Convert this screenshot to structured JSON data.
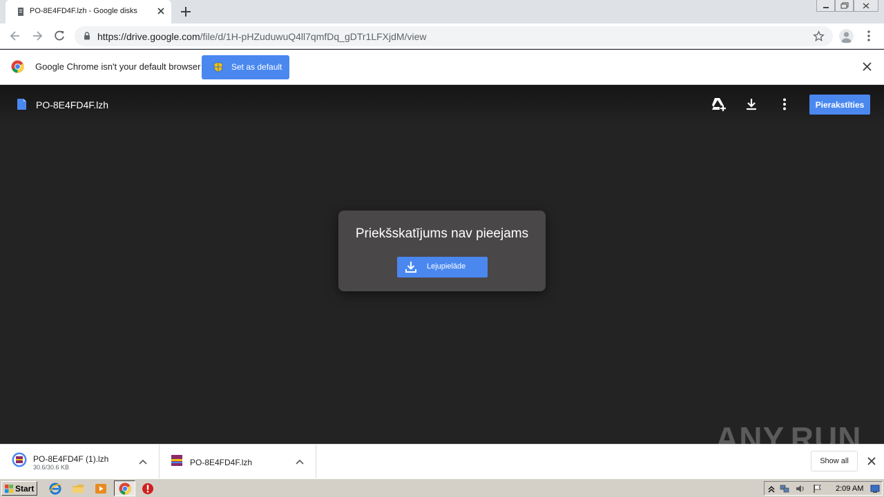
{
  "tab": {
    "title": "PO-8E4FD4F.lzh - Google disks"
  },
  "toolbar": {
    "url_host": "https://drive.google.com",
    "url_path": "/file/d/1H-pHZuduwuQ4ll7qmfDq_gDTr1LFXjdM/view"
  },
  "infobar": {
    "message": "Google Chrome isn't your default browser",
    "set_default_label": "Set as default"
  },
  "viewer": {
    "file_name": "PO-8E4FD4F.lzh",
    "sign_in_label": "Pierakstīties",
    "no_preview_text": "Priekšskatījums nav pieejams",
    "download_label": "Lejupielāde"
  },
  "downloads": {
    "items": [
      {
        "name": "PO-8E4FD4F (1).lzh",
        "size": "30.6/30.6 KB"
      },
      {
        "name": "PO-8E4FD4F.lzh",
        "size": ""
      }
    ],
    "show_all_label": "Show all"
  },
  "watermark": "ANY.RUN",
  "taskbar": {
    "start_label": "Start",
    "clock": "2:09 AM"
  },
  "colors": {
    "accent": "#4a88f0",
    "viewer_bg": "#232323",
    "dialog_bg": "#4a4748"
  }
}
